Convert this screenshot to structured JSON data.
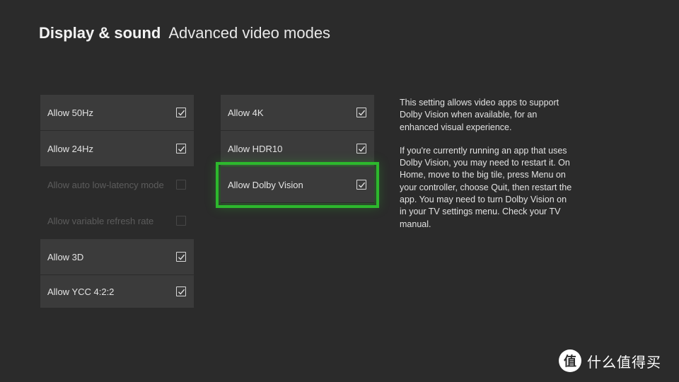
{
  "header": {
    "section": "Display & sound",
    "page": "Advanced video modes"
  },
  "left_column": [
    {
      "label": "Allow 50Hz",
      "checked": true,
      "enabled": true
    },
    {
      "label": "Allow 24Hz",
      "checked": true,
      "enabled": true
    },
    {
      "label": "Allow auto low-latency mode",
      "checked": false,
      "enabled": false
    },
    {
      "label": "Allow variable refresh rate",
      "checked": false,
      "enabled": false
    },
    {
      "label": "Allow 3D",
      "checked": true,
      "enabled": true
    },
    {
      "label": "Allow YCC 4:2:2",
      "checked": true,
      "enabled": true
    }
  ],
  "middle_column": [
    {
      "label": "Allow 4K",
      "checked": true,
      "enabled": true
    },
    {
      "label": "Allow HDR10",
      "checked": true,
      "enabled": true
    },
    {
      "label": "Allow Dolby Vision",
      "checked": true,
      "enabled": true,
      "focused": true
    }
  ],
  "description": {
    "p1": "This setting allows video apps to support Dolby Vision when available, for an enhanced visual experience.",
    "p2": "If you're currently running an app that uses Dolby Vision, you may need to restart it. On Home, move to the big tile, press Menu on your controller, choose Quit, then restart the app. You may need to turn Dolby Vision on in your TV settings menu. Check your TV manual."
  },
  "watermark": {
    "logo_glyph": "值",
    "text": "什么值得买"
  },
  "colors": {
    "background": "#2b2b2b",
    "tile": "#3b3b3b",
    "focus": "#2db82d"
  }
}
